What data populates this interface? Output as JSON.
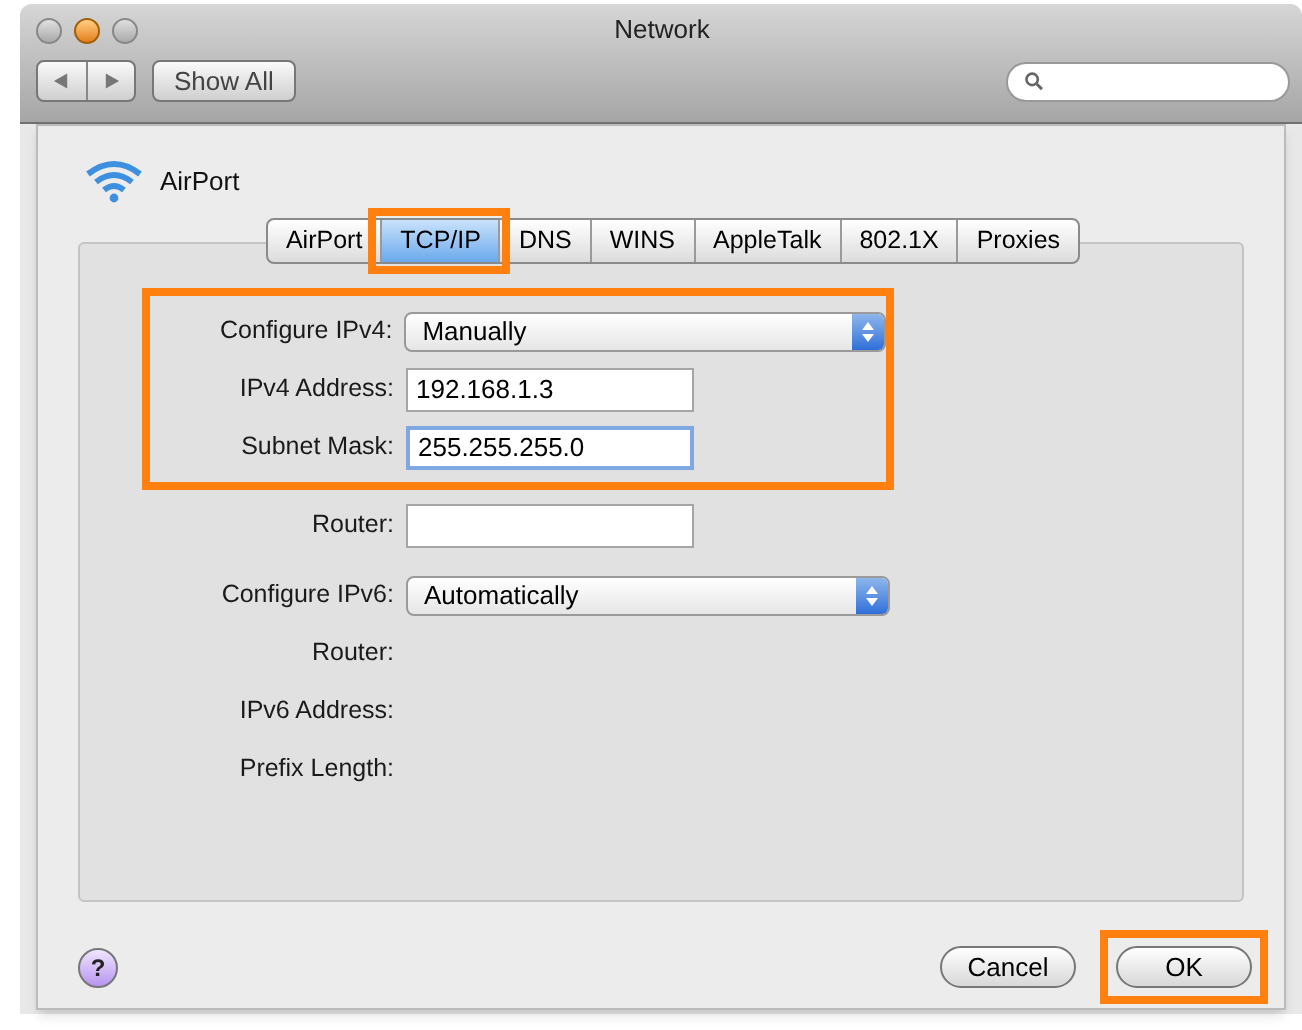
{
  "window": {
    "title": "Network"
  },
  "toolbar": {
    "show_all": "Show All"
  },
  "service": {
    "name": "AirPort"
  },
  "tabs": [
    {
      "label": "AirPort",
      "selected": false,
      "highlighted": false
    },
    {
      "label": "TCP/IP",
      "selected": true,
      "highlighted": true
    },
    {
      "label": "DNS",
      "selected": false,
      "highlighted": false
    },
    {
      "label": "WINS",
      "selected": false,
      "highlighted": false
    },
    {
      "label": "AppleTalk",
      "selected": false,
      "highlighted": false
    },
    {
      "label": "802.1X",
      "selected": false,
      "highlighted": false
    },
    {
      "label": "Proxies",
      "selected": false,
      "highlighted": false
    }
  ],
  "ipv4_group": {
    "highlighted": true,
    "rows": [
      {
        "label": "Configure IPv4:",
        "kind": "popup",
        "value": "Manually"
      },
      {
        "label": "IPv4 Address:",
        "kind": "text",
        "value": "192.168.1.3",
        "focused": false
      },
      {
        "label": "Subnet Mask:",
        "kind": "text",
        "value": "255.255.255.0",
        "focused": true
      }
    ]
  },
  "rows": [
    {
      "label": "Router:",
      "kind": "text",
      "value": "",
      "focused": false
    },
    {
      "label": "Configure IPv6:",
      "kind": "popup",
      "value": "Automatically"
    },
    {
      "label": "Router:",
      "kind": "static"
    },
    {
      "label": "IPv6 Address:",
      "kind": "static"
    },
    {
      "label": "Prefix Length:",
      "kind": "static"
    }
  ],
  "buttons": [
    {
      "label": "Cancel",
      "highlighted": false
    },
    {
      "label": "OK",
      "highlighted": true
    }
  ],
  "help": "?"
}
